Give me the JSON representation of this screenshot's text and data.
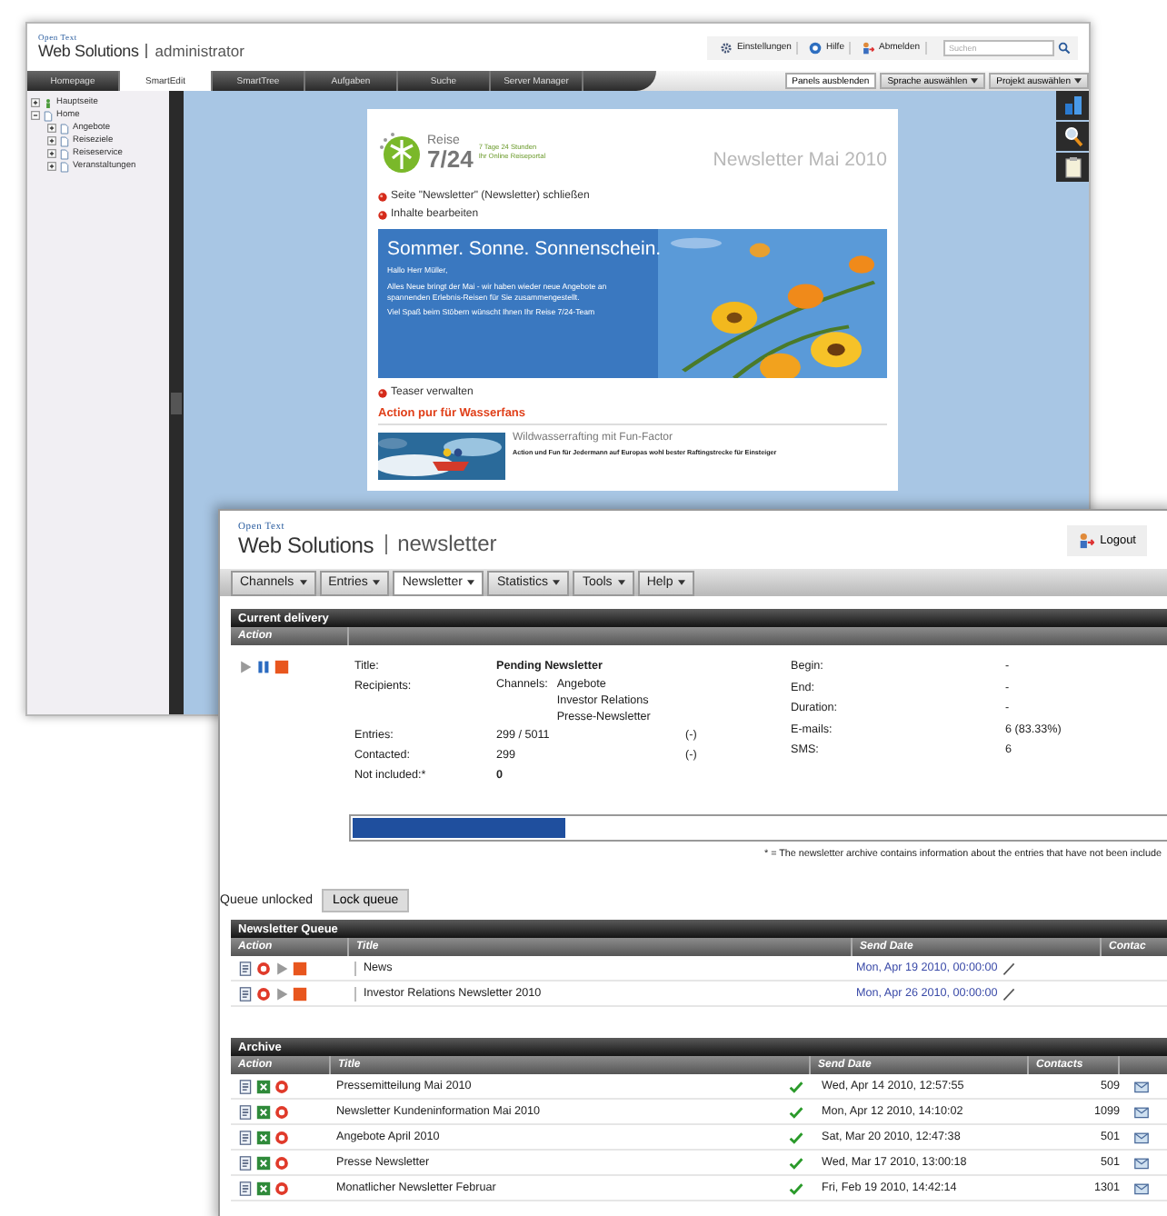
{
  "admin_window": {
    "brand": "Open Text",
    "product": "Web Solutions",
    "section": "administrator",
    "header_links": [
      {
        "label": "Einstellungen",
        "kind": "gear"
      },
      {
        "label": "Hilfe",
        "kind": "help"
      },
      {
        "label": "Abmelden",
        "kind": "logout"
      }
    ],
    "search": {
      "placeholder": "Suchen"
    },
    "tabs": [
      {
        "label": "Homepage",
        "selected": false
      },
      {
        "label": "SmartEdit",
        "selected": true
      },
      {
        "label": "SmartTree",
        "selected": false
      },
      {
        "label": "Aufgaben",
        "selected": false
      },
      {
        "label": "Suche",
        "selected": false
      },
      {
        "label": "Server Manager",
        "selected": false
      }
    ],
    "toolbar_buttons": [
      {
        "label": "Panels ausblenden",
        "kind": "plain"
      },
      {
        "label": "Sprache auswählen",
        "kind": "dropdown"
      },
      {
        "label": "Projekt auswählen",
        "kind": "dropdown"
      }
    ],
    "tree": [
      {
        "label": "Hauptseite",
        "kind": "start",
        "expanded": false
      },
      {
        "label": "Home",
        "kind": "page",
        "expanded": true,
        "children": [
          {
            "label": "Angebote",
            "kind": "page",
            "expanded": false
          },
          {
            "label": "Reiseziele",
            "kind": "page",
            "expanded": false
          },
          {
            "label": "Reiseservice",
            "kind": "page",
            "expanded": false
          },
          {
            "label": "Veranstaltungen",
            "kind": "page",
            "expanded": false
          }
        ]
      }
    ],
    "preview": {
      "logo_name": "Reise",
      "logo_number": "7/24",
      "tagline": [
        "7 Tage 24 Stunden",
        "Ihr Online Reiseportal"
      ],
      "issue": "Newsletter Mai 2010",
      "edit_links": [
        "Seite \"Newsletter\" (Newsletter) schließen",
        "Inhalte bearbeiten"
      ],
      "banner": {
        "headline": "Sommer. Sonne. Sonnenschein.",
        "paragraphs": [
          "Hallo Herr Müller,",
          "Alles Neue bringt der Mai - wir haben wieder neue Angebote an spannenden Erlebnis-Reisen für Sie zusammengestellt.",
          "Viel Spaß beim Stöbern wünscht Ihnen Ihr Reise 7/24-Team"
        ]
      },
      "teaser_link": "Teaser verwalten",
      "section_title": "Action pur für Wasserfans",
      "article": {
        "title": "Wildwasserrafting mit Fun-Factor",
        "summary": "Action und Fun für Jedermann auf Europas wohl bester Raftingstrecke für Einsteiger"
      }
    }
  },
  "newsletter_window": {
    "brand": "Open Text",
    "product": "Web Solutions",
    "section": "newsletter",
    "logout": "Logout",
    "menu": [
      {
        "label": "Channels",
        "selected": false
      },
      {
        "label": "Entries",
        "selected": false
      },
      {
        "label": "Newsletter",
        "selected": true
      },
      {
        "label": "Statistics",
        "selected": false
      },
      {
        "label": "Tools",
        "selected": false
      },
      {
        "label": "Help",
        "selected": false
      }
    ],
    "current_delivery": {
      "title": "Current delivery",
      "action_header": "Action",
      "left_rows": [
        {
          "kind": "title",
          "label": "Title:",
          "value": "Pending Newsletter"
        },
        {
          "kind": "recipients",
          "label": "Recipients:",
          "sublabel": "Channels:",
          "values": [
            "Angebote",
            "Investor Relations",
            "Presse-Newsletter"
          ]
        },
        {
          "kind": "count",
          "label": "Entries:",
          "value": "299 / 5011",
          "extra": "(-)"
        },
        {
          "kind": "count",
          "label": "Contacted:",
          "value": "299",
          "extra": "(-)"
        },
        {
          "kind": "title",
          "label": "Not included:*",
          "value": "0"
        }
      ],
      "right_rows": [
        {
          "label": "Begin:",
          "value": "-"
        },
        {
          "label": "End:",
          "value": "-"
        },
        {
          "label": "Duration:",
          "value": "-"
        },
        {
          "label": "E-mails:",
          "value": "6 (83.33%)"
        },
        {
          "label": "SMS:",
          "value": "6"
        }
      ],
      "progress": {
        "level": 0.26
      },
      "footnote": "* = The newsletter archive contains information about the entries that have not been include"
    },
    "queue_status": "Queue unlocked",
    "lock_button": "Lock queue",
    "queue": {
      "title": "Newsletter Queue",
      "columns": [
        "Action",
        "Title",
        "Send Date",
        "Contac"
      ],
      "rows": [
        {
          "title": "News",
          "send_date": "Mon, Apr 19 2010, 00:00:00"
        },
        {
          "title": "Investor Relations Newsletter 2010",
          "send_date": "Mon, Apr 26 2010, 00:00:00"
        }
      ]
    },
    "archive": {
      "title": "Archive",
      "columns": [
        "Action",
        "Title",
        "Send Date",
        "Contacts"
      ],
      "rows": [
        {
          "title": "Pressemitteilung Mai 2010",
          "sent": true,
          "send_date": "Wed, Apr 14 2010, 12:57:55",
          "contacts": "509"
        },
        {
          "title": "Newsletter Kundeninformation Mai 2010",
          "sent": true,
          "send_date": "Mon, Apr 12 2010, 14:10:02",
          "contacts": "1099"
        },
        {
          "title": "Angebote April 2010",
          "sent": true,
          "send_date": "Sat, Mar 20 2010, 12:47:38",
          "contacts": "501"
        },
        {
          "title": "Presse Newsletter",
          "sent": true,
          "send_date": "Wed, Mar 17 2010, 13:00:18",
          "contacts": "501"
        },
        {
          "title": "Monatlicher Newsletter Februar",
          "sent": true,
          "send_date": "Fri, Feb 19 2010, 14:42:14",
          "contacts": "1301"
        }
      ]
    }
  }
}
